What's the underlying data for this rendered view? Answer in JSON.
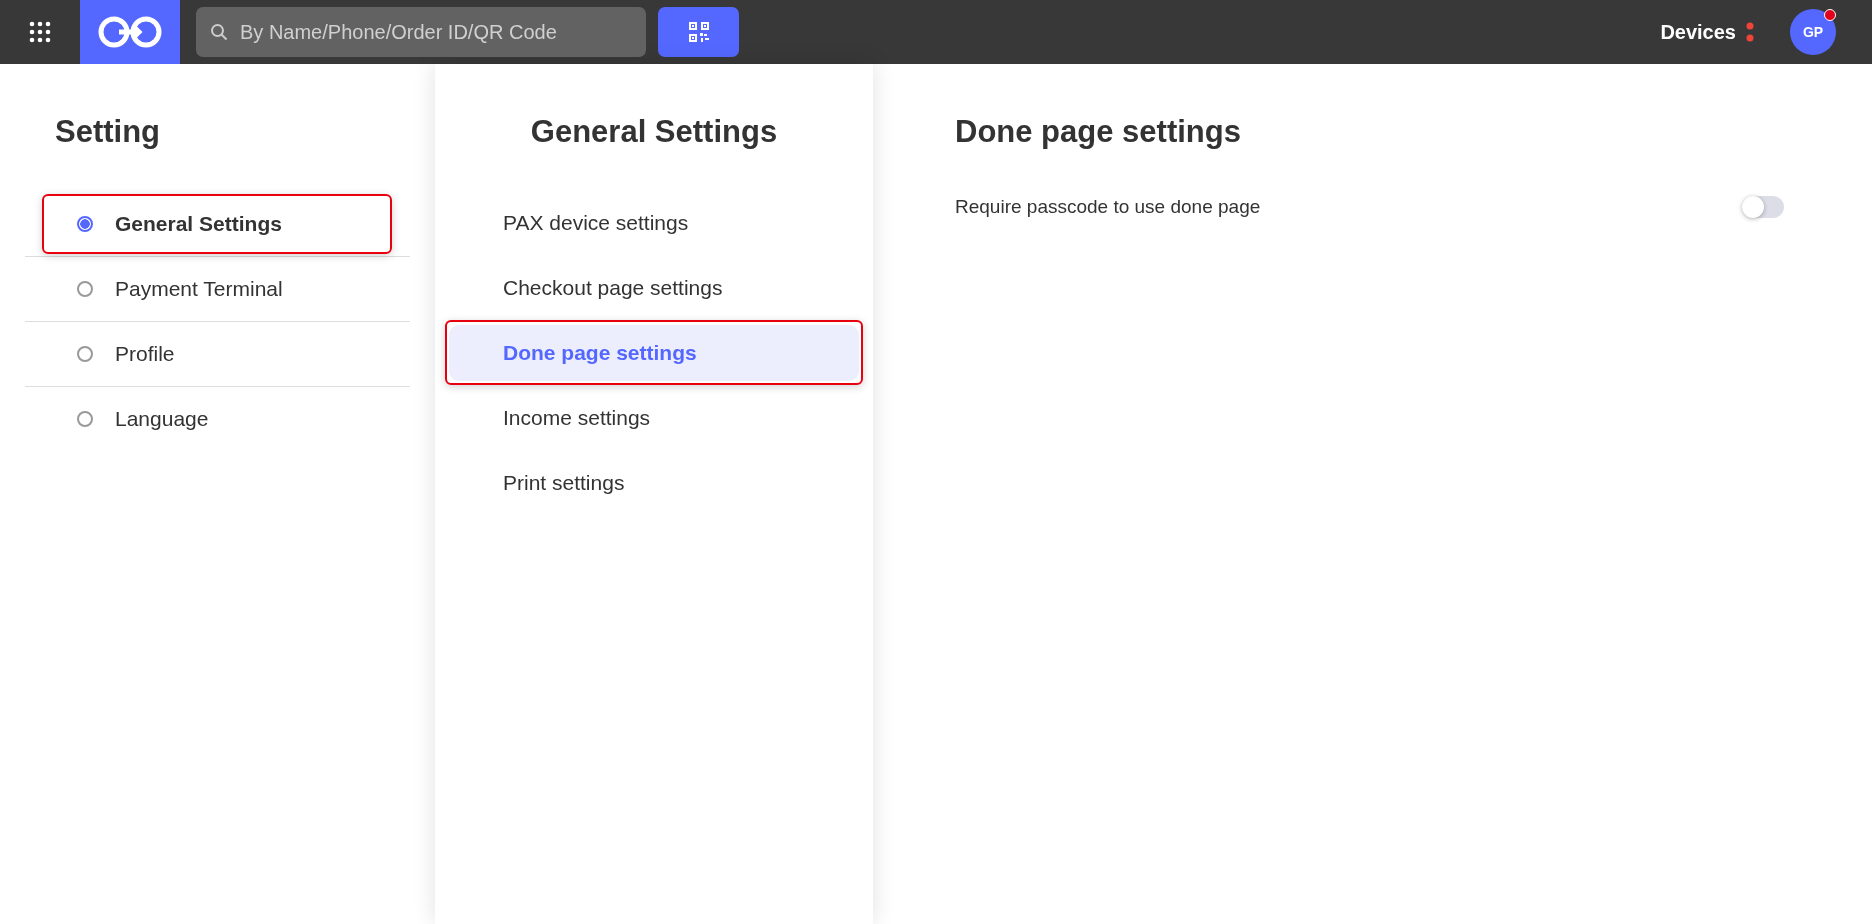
{
  "topbar": {
    "search": {
      "placeholder": "By Name/Phone/Order ID/QR Code"
    },
    "devices": "Devices",
    "avatar": {
      "initials": "GP",
      "notification": true
    }
  },
  "sidebar": {
    "title": "Setting",
    "items": [
      {
        "label": "General Settings",
        "selected": true
      },
      {
        "label": "Payment Terminal",
        "selected": false
      },
      {
        "label": "Profile",
        "selected": false
      },
      {
        "label": "Language",
        "selected": false
      }
    ]
  },
  "submenu": {
    "title": "General Settings",
    "items": [
      {
        "label": "PAX device settings",
        "selected": false
      },
      {
        "label": "Checkout page settings",
        "selected": false
      },
      {
        "label": "Done page settings",
        "selected": true
      },
      {
        "label": "Income settings",
        "selected": false
      },
      {
        "label": "Print settings",
        "selected": false
      }
    ]
  },
  "content": {
    "title": "Done page settings",
    "settings": [
      {
        "label": "Require passcode to use done page",
        "on": false
      }
    ]
  }
}
